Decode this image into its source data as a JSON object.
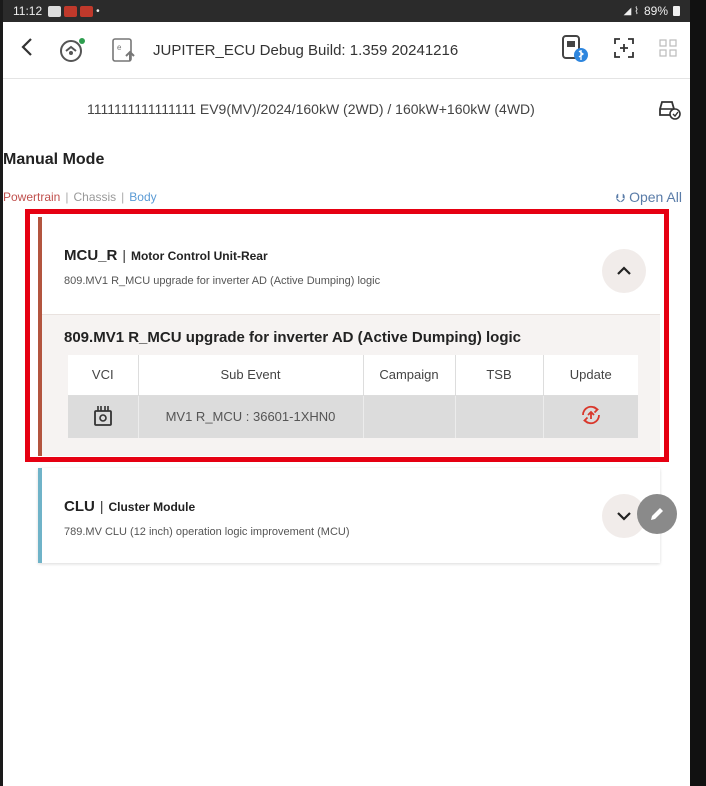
{
  "status_bar": {
    "time": "11:12",
    "battery": "89%"
  },
  "toolbar": {
    "back_icon": "chevron-left-icon",
    "title": "JUPITER_ECU Debug Build: 1.359 20241216"
  },
  "vehicle": {
    "description": "1111111111111111  EV9(MV)/2024/160kW (2WD) / 160kW+160kW (4WD)"
  },
  "page": {
    "title": "Manual Mode",
    "filters": [
      "Powertrain",
      "Chassis",
      "Body"
    ],
    "open_all": "Open All"
  },
  "modules": [
    {
      "code": "MCU_R",
      "name": "Motor Control Unit-Rear",
      "summary": "809.MV1 R_MCU upgrade for inverter AD (Active Dumping) logic",
      "expanded": true,
      "detail_title": "809.MV1 R_MCU upgrade for inverter AD (Active Dumping) logic",
      "columns": [
        "VCI",
        "Sub Event",
        "Campaign",
        "TSB",
        "Update"
      ],
      "rows": [
        {
          "vci_icon": "vci-device-icon",
          "sub_event": "MV1 R_MCU : 36601-1XHN0",
          "campaign": "",
          "tsb": "",
          "update_icon": "update-icon"
        }
      ]
    },
    {
      "code": "CLU",
      "name": "Cluster Module",
      "summary": "789.MV CLU (12 inch) operation logic improvement (MCU)",
      "expanded": false
    }
  ],
  "colors": {
    "highlight": "#e60012",
    "accent_powertrain": "#c0504d",
    "accent_body": "#5b9bd5",
    "card1_border": "#b3553f",
    "card2_border": "#6fb3c8",
    "update_icon": "#d9372b"
  }
}
